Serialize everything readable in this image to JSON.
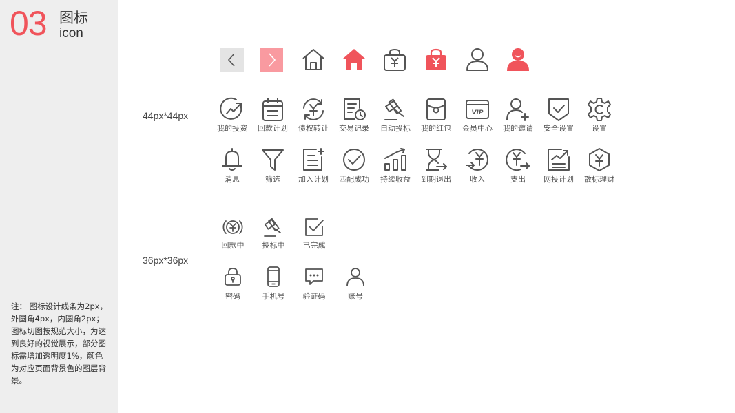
{
  "header": {
    "number": "03",
    "title_cn": "图标",
    "title_en": "icon"
  },
  "note": "注： 图标设计线条为2px，外圆角4px，内圆角2px；图标切图按规范大小，为达到良好的视觉展示，部分图标需增加透明度1%，颜色为对应页面背景色的图层背景。",
  "sections": {
    "large": "44px*44px",
    "small": "36px*36px"
  },
  "colors": {
    "accent": "#f0545b",
    "accent_light": "#f99aa0",
    "icon_stroke": "#555555",
    "sidebar_bg": "#eeeeee"
  },
  "top_row": [
    "chevron-left-icon",
    "chevron-right-icon",
    "home-outline-icon",
    "home-filled-icon",
    "wallet-outline-icon",
    "wallet-filled-icon",
    "user-outline-icon",
    "user-filled-icon"
  ],
  "row1": [
    {
      "icon": "trend-up-icon",
      "label": "我的投资"
    },
    {
      "icon": "calendar-plan-icon",
      "label": "回款计划"
    },
    {
      "icon": "yen-refresh-icon",
      "label": "债权转让"
    },
    {
      "icon": "record-clock-icon",
      "label": "交易记录"
    },
    {
      "icon": "gavel-icon",
      "label": "自动投标"
    },
    {
      "icon": "red-envelope-icon",
      "label": "我的红包"
    },
    {
      "icon": "vip-card-icon",
      "label": "会员中心"
    },
    {
      "icon": "user-add-icon",
      "label": "我的邀请"
    },
    {
      "icon": "shield-check-icon",
      "label": "安全设置"
    },
    {
      "icon": "gear-icon",
      "label": "设置"
    }
  ],
  "row2": [
    {
      "icon": "bell-icon",
      "label": "消息"
    },
    {
      "icon": "filter-icon",
      "label": "筛选"
    },
    {
      "icon": "list-add-icon",
      "label": "加入计划"
    },
    {
      "icon": "check-circle-icon",
      "label": "匹配成功"
    },
    {
      "icon": "bar-growth-icon",
      "label": "持续收益"
    },
    {
      "icon": "hourglass-exit-icon",
      "label": "到期退出"
    },
    {
      "icon": "yen-in-icon",
      "label": "收入"
    },
    {
      "icon": "yen-out-icon",
      "label": "支出"
    },
    {
      "icon": "online-plan-icon",
      "label": "网投计划"
    },
    {
      "icon": "hexagon-yen-icon",
      "label": "散标理财"
    }
  ],
  "small_row1": [
    {
      "icon": "yen-coins-icon",
      "label": "回款中"
    },
    {
      "icon": "gavel-small-icon",
      "label": "投标中"
    },
    {
      "icon": "checkbox-icon",
      "label": "已完成"
    }
  ],
  "small_row2": [
    {
      "icon": "lock-icon",
      "label": "密码"
    },
    {
      "icon": "phone-icon",
      "label": "手机号"
    },
    {
      "icon": "chat-dots-icon",
      "label": "验证码"
    },
    {
      "icon": "account-icon",
      "label": "账号"
    }
  ]
}
